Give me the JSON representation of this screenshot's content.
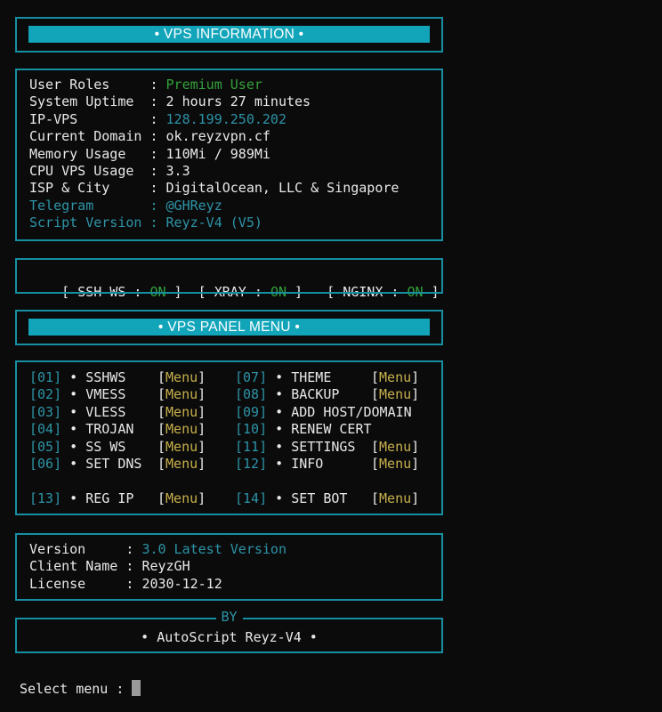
{
  "header1": {
    "title": "• VPS INFORMATION •"
  },
  "info": [
    {
      "label": "User Roles     ",
      "sep": ": ",
      "value": "Premium User",
      "style": "green",
      "labelStyle": "white"
    },
    {
      "label": "System Uptime  ",
      "sep": ": ",
      "value": "2 hours 27 minutes",
      "style": "white",
      "labelStyle": "white"
    },
    {
      "label": "IP-VPS         ",
      "sep": ": ",
      "value": "128.199.250.202",
      "style": "teal",
      "labelStyle": "white"
    },
    {
      "label": "Current Domain ",
      "sep": ": ",
      "value": "ok.reyzvpn.cf",
      "style": "white",
      "labelStyle": "white"
    },
    {
      "label": "Memory Usage   ",
      "sep": ": ",
      "value": "110Mi / 989Mi",
      "style": "white",
      "labelStyle": "white"
    },
    {
      "label": "CPU VPS Usage  ",
      "sep": ": ",
      "value": "3.3",
      "style": "white",
      "labelStyle": "white"
    },
    {
      "label": "ISP & City     ",
      "sep": ": ",
      "value": "DigitalOcean, LLC & Singapore",
      "style": "white",
      "labelStyle": "white"
    },
    {
      "label": "Telegram       ",
      "sep": ": ",
      "value": "@GHReyz",
      "style": "teal",
      "labelStyle": "teal"
    },
    {
      "label": "Script Version ",
      "sep": ": ",
      "value": "Reyz-V4 (V5)",
      "style": "teal",
      "labelStyle": "teal"
    }
  ],
  "status": [
    {
      "name": "SSH WS",
      "state": "ON"
    },
    {
      "name": "XRAY",
      "state": "ON"
    },
    {
      "name": "NGINX",
      "state": "ON"
    }
  ],
  "header2": {
    "title": "• VPS PANEL MENU •"
  },
  "menu_left": [
    {
      "num": "[01]",
      "label": "SSHWS  ",
      "tag": "Menu"
    },
    {
      "num": "[02]",
      "label": "VMESS  ",
      "tag": "Menu"
    },
    {
      "num": "[03]",
      "label": "VLESS  ",
      "tag": "Menu"
    },
    {
      "num": "[04]",
      "label": "TROJAN ",
      "tag": "Menu"
    },
    {
      "num": "[05]",
      "label": "SS WS  ",
      "tag": "Menu"
    },
    {
      "num": "[06]",
      "label": "SET DNS",
      "tag": "Menu"
    },
    {
      "num": "[13]",
      "label": "REG IP ",
      "tag": "Menu"
    }
  ],
  "menu_right": [
    {
      "num": "[07]",
      "label": "THEME   ",
      "tag": "Menu"
    },
    {
      "num": "[08]",
      "label": "BACKUP  ",
      "tag": "Menu"
    },
    {
      "num": "[09]",
      "label": "ADD HOST/DOMAIN",
      "tag": ""
    },
    {
      "num": "[10]",
      "label": "RENEW CERT",
      "tag": ""
    },
    {
      "num": "[11]",
      "label": "SETTINGS",
      "tag": "Menu"
    },
    {
      "num": "[12]",
      "label": "INFO    ",
      "tag": "Menu"
    },
    {
      "num": "[14]",
      "label": "SET BOT ",
      "tag": "Menu"
    }
  ],
  "version": [
    {
      "label": "Version     ",
      "sep": ": ",
      "value": "3.0 Latest Version",
      "style": "teal"
    },
    {
      "label": "Client Name ",
      "sep": ": ",
      "value": "ReyzGH",
      "style": "white"
    },
    {
      "label": "License     ",
      "sep": ": ",
      "value": "2030-12-12",
      "style": "white"
    }
  ],
  "by": {
    "label": "BY",
    "text": "• AutoScript Reyz-V4 •"
  },
  "prompt": {
    "text": "Select menu : "
  },
  "colors": {
    "frame": "#168fa3",
    "bar": "#12a5ba",
    "green": "#35a13a",
    "teal": "#2d94a6",
    "yellow": "#c8b04b"
  }
}
